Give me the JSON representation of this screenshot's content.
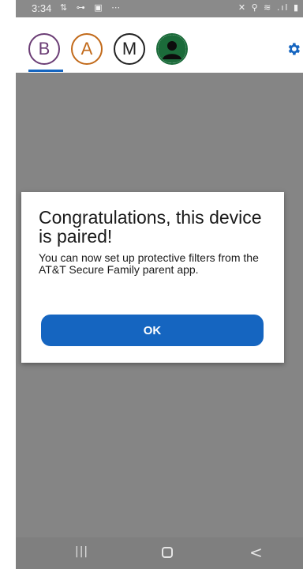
{
  "status_bar": {
    "time": "3:34",
    "left_icons": [
      "data-arrows-icon",
      "link-icon",
      "image-icon",
      "more-dots-icon"
    ],
    "left_icons_text": "⇅ ⊶ ▣ ⋯",
    "right_icons_text": "✕ ⚲ ≋ .ıl ▮"
  },
  "app_bar": {
    "avatars": [
      {
        "letter": "B",
        "color": "#6b3d75"
      },
      {
        "letter": "A",
        "color": "#c26a1a"
      },
      {
        "letter": "M",
        "color": "#222222"
      },
      {
        "icon": "person-icon",
        "color": "#1b6b3a"
      }
    ],
    "accent": "#1565c0",
    "settings_icon": "gear-icon"
  },
  "dialog": {
    "title": "Congratulations, this device is paired!",
    "body": "You can now set up protective filters from the AT&T Secure Family parent app.",
    "ok_label": "OK",
    "button_color": "#1565c0"
  },
  "nav_bar": {
    "recents_glyph": "|||",
    "back_glyph": "<"
  }
}
